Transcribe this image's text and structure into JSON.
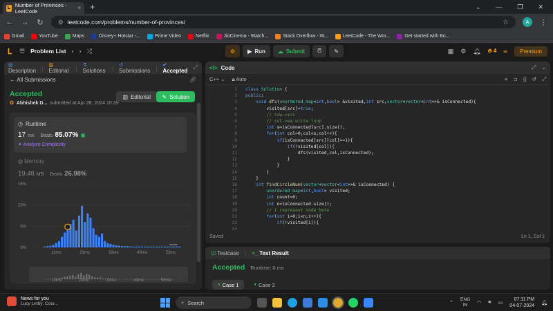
{
  "browser": {
    "tab_title": "Number of Provinces - LeetCode",
    "tab_close": "×",
    "new_tab": "+",
    "window_controls": [
      "⌄",
      "—",
      "❐",
      "✕"
    ],
    "url": "leetcode.com/problems/number-of-provinces/",
    "profile_initial": "A",
    "bookmarks": [
      {
        "label": "Gmail",
        "color": "#ea4335"
      },
      {
        "label": "YouTube",
        "color": "#ff0000"
      },
      {
        "label": "Maps",
        "color": "#34a853"
      },
      {
        "label": "Disney+ Hotstar -...",
        "color": "#1f3b8f"
      },
      {
        "label": "Prime Video",
        "color": "#00a8e1"
      },
      {
        "label": "Netflix",
        "color": "#e50914"
      },
      {
        "label": "JioCinema - Watch...",
        "color": "#c2185b"
      },
      {
        "label": "Stack Overflow - W...",
        "color": "#f48024"
      },
      {
        "label": "LeetCode - The Wor...",
        "color": "#ffa116"
      },
      {
        "label": "Get started with Bo...",
        "color": "#8e24aa"
      }
    ]
  },
  "lcnav": {
    "problem_list": "Problem List",
    "run": "Run",
    "submit": "Submit",
    "streak": "4",
    "premium": "Premium"
  },
  "left_tabs": [
    "Description",
    "Editorial",
    "Solutions",
    "Submissions",
    "Accepted"
  ],
  "submission": {
    "back": "All Submissions",
    "status": "Accepted",
    "user": "Abhishek D...",
    "submitted": "submitted at Apr 28, 2024 10:39",
    "editorial_btn": "Editorial",
    "solution_btn": "Solution",
    "runtime_label": "Runtime",
    "runtime_value": "17",
    "runtime_unit": "ms",
    "beats_label": "Beats",
    "runtime_beats": "85.07%",
    "analyze": "Analyze Complexity",
    "memory_label": "Memory",
    "memory_value": "19.48",
    "memory_unit": "MB",
    "memory_beats": "26.98%"
  },
  "chart_data": {
    "type": "bar",
    "xlabel": "",
    "ylabel": "",
    "yticks": [
      "15%",
      "10%",
      "5%",
      "0%"
    ],
    "ylim": [
      0,
      15
    ],
    "xticks": [
      "13ms",
      "23ms",
      "33ms",
      "43ms",
      "53ms"
    ],
    "x_range": [
      4,
      60
    ],
    "x": [
      9,
      10,
      11,
      12,
      13,
      14,
      15,
      16,
      17,
      18,
      19,
      20,
      21,
      22,
      23,
      24,
      25,
      26,
      27,
      28,
      29,
      30,
      31,
      32,
      33,
      34,
      35,
      36,
      37,
      38,
      39,
      40,
      41,
      42,
      43,
      44,
      45,
      46,
      47,
      48,
      49,
      50,
      51,
      52,
      53,
      54,
      55,
      56
    ],
    "values": [
      0.2,
      0.3,
      0.4,
      0.6,
      1.0,
      1.5,
      2.5,
      3.5,
      4.2,
      5.5,
      6.5,
      4.0,
      7.5,
      9.8,
      6.0,
      8.0,
      7.0,
      4.5,
      3.0,
      2.5,
      3.3,
      1.5,
      1.0,
      0.8,
      0.6,
      0.5,
      0.4,
      0.3,
      0.3,
      0.3,
      0.2,
      0.2,
      0.2,
      0.2,
      0.2,
      0.2,
      0.2,
      0.2,
      0.2,
      0.2,
      0.2,
      0.2,
      0.2,
      0.2,
      0.2,
      0.2,
      0.2,
      0.2
    ],
    "highlight_x": 17
  },
  "code_panel": {
    "title": "Code",
    "language": "C++",
    "auto": "Auto",
    "saved": "Saved",
    "cursor": "Ln 1, Col 1",
    "line_numbers": [
      "1",
      "2",
      "3",
      "4",
      "5",
      "6",
      "7",
      "8",
      "9",
      "10",
      "11",
      "12",
      "13",
      "14",
      "15",
      "16",
      "17",
      "18",
      "19",
      "20",
      "21",
      "22",
      "23"
    ]
  },
  "bottom": {
    "testcase": "Testcase",
    "result_tab": "Test Result",
    "status": "Accepted",
    "runtime": "Runtime: 0 ms",
    "case1": "Case 1",
    "case2": "Case 2"
  },
  "taskbar": {
    "news_title": "News for you",
    "news_sub": "Lucy Letby: Cour...",
    "search": "Search",
    "lang1": "ENG",
    "lang2": "IN",
    "time": "07:11 PM",
    "date": "04-07-2024"
  }
}
